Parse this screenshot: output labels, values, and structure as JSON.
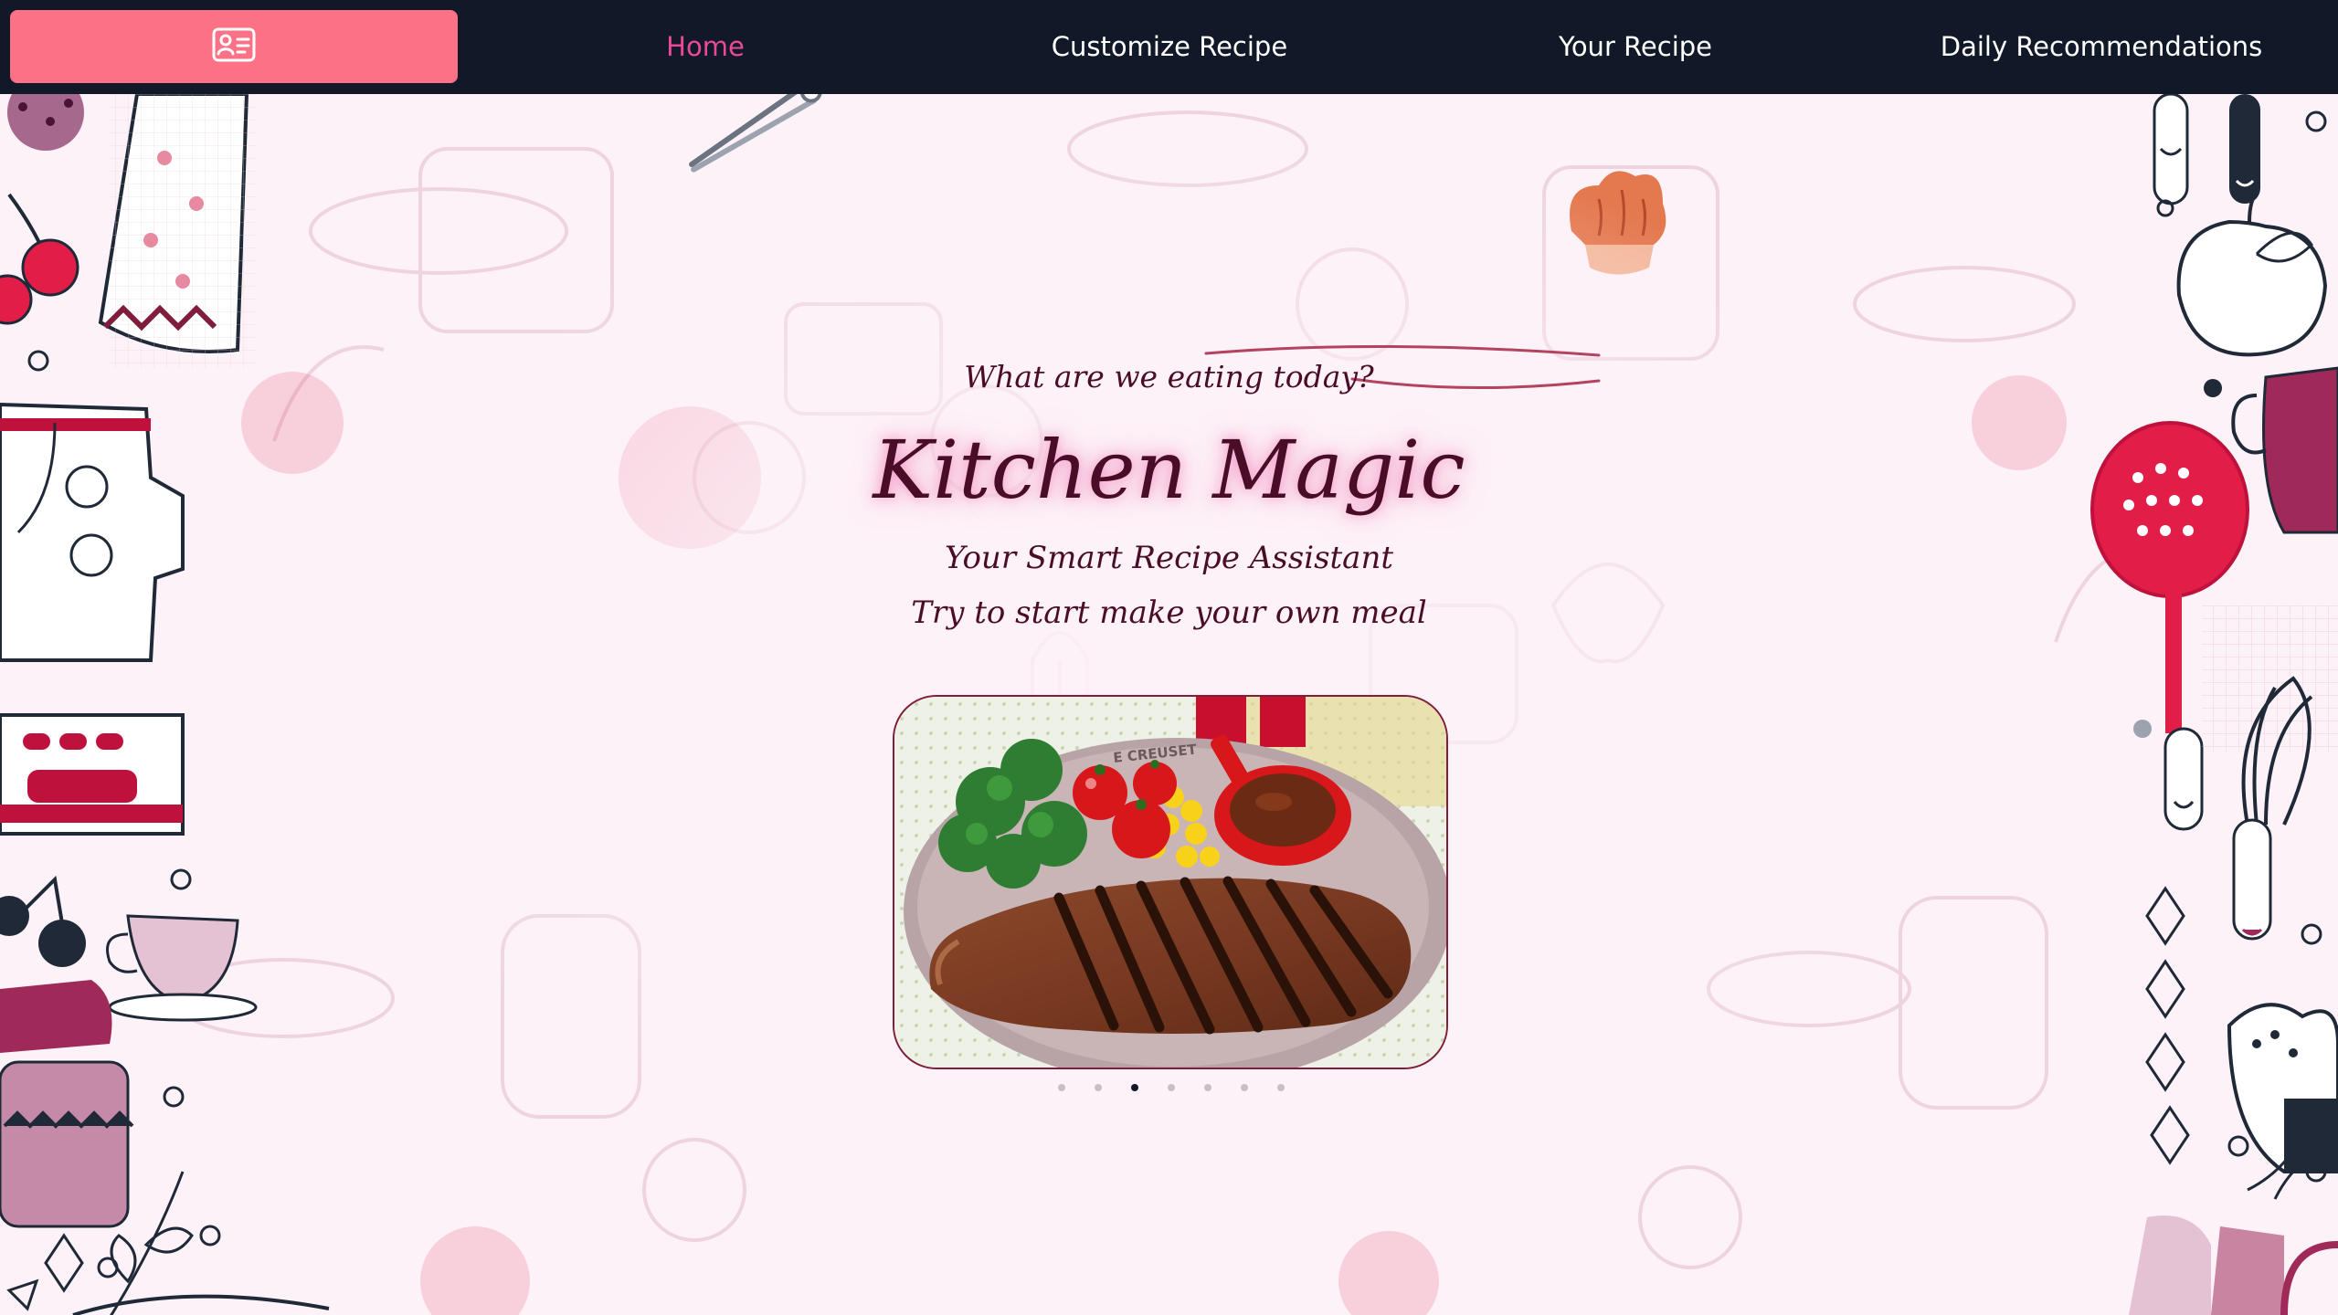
{
  "navbar": {
    "logo_icon": "id-card-icon",
    "links": [
      {
        "label": "Home",
        "active": true
      },
      {
        "label": "Customize Recipe",
        "active": false
      },
      {
        "label": "Your Recipe",
        "active": false
      },
      {
        "label": "Daily Recommendations",
        "active": false
      }
    ]
  },
  "hero": {
    "tagline": "What are we eating today?",
    "title": "Kitchen Magic",
    "subtitle": "Your Smart Recipe Assistant",
    "cta_text": "Try to start make your own meal",
    "carousel": {
      "slide_count": 7,
      "active_index": 2,
      "plate_text": "E CREUSET"
    }
  },
  "colors": {
    "navbar_bg": "#111827",
    "logo_button_bg": "#fb7185",
    "active_link": "#ec4899",
    "page_bg": "#fdf2f8",
    "title_text": "#4a0d27"
  }
}
